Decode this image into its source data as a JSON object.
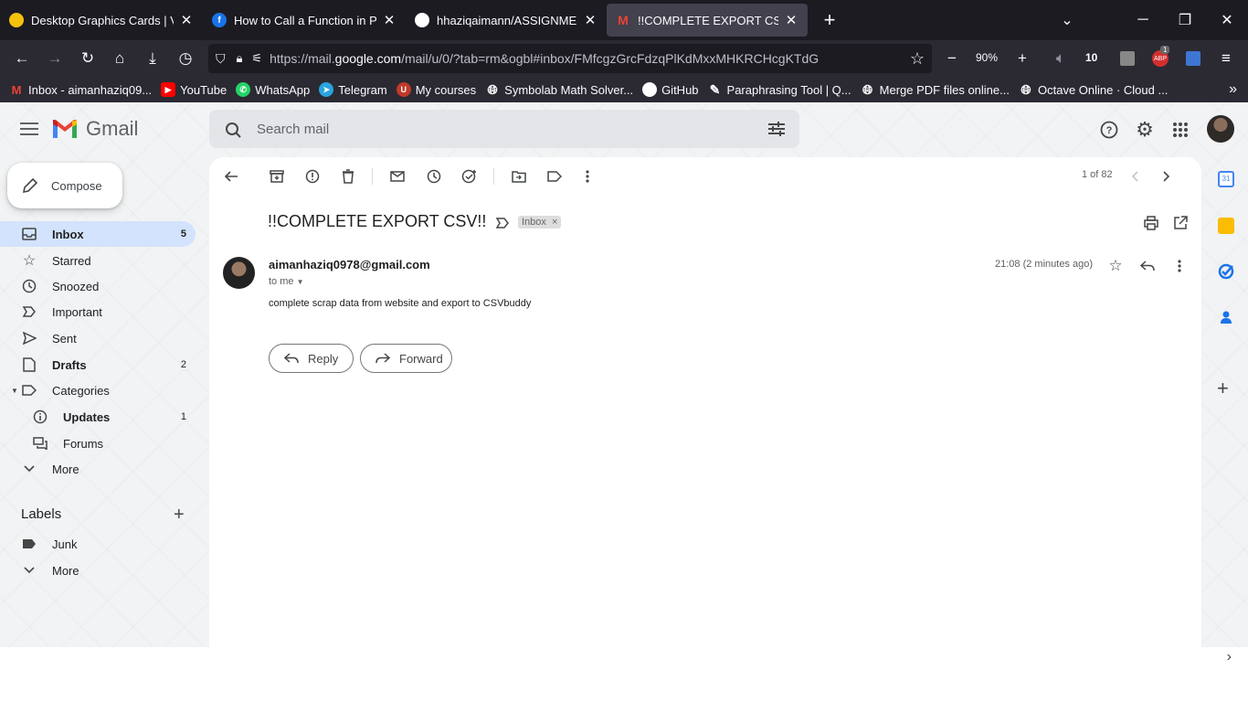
{
  "browser": {
    "tabs": [
      {
        "title": "Desktop Graphics Cards | Video",
        "icon": "nvidia-icon",
        "color": "#f4c20d"
      },
      {
        "title": "How to Call a Function in Pytho",
        "icon": "freecodecamp-icon",
        "color": "#1a73e8"
      },
      {
        "title": "hhaziqaimann/ASSIGNMENT-",
        "icon": "github-icon",
        "color": "#ffffff"
      },
      {
        "title": "!!COMPLETE EXPORT CSV!! - aim",
        "icon": "gmail-icon",
        "color": "#ea4335"
      }
    ],
    "url_prefix": "https://mail.",
    "url_domain": "google.com",
    "url_suffix": "/mail/u/0/?tab=rm&ogbl#inbox/FMfcgzGrcFdzqPlKdMxxMHKRCHcgKTdG",
    "zoom": "90%",
    "ext_badge_count": "1",
    "ext_badge_abp": "ABP",
    "ext_10": "10",
    "bookmarks": [
      {
        "label": "Inbox - aimanhaziq09...",
        "icon": "gmail-icon",
        "color": "#ea4335"
      },
      {
        "label": "YouTube",
        "icon": "youtube-icon",
        "color": "#ff0000"
      },
      {
        "label": "WhatsApp",
        "icon": "whatsapp-icon",
        "color": "#25d366"
      },
      {
        "label": "Telegram",
        "icon": "telegram-icon",
        "color": "#2aa3df"
      },
      {
        "label": "My courses",
        "icon": "courses-icon",
        "color": "#c0392b"
      },
      {
        "label": "Symbolab Math Solver...",
        "icon": "globe-icon",
        "color": "#2b2a33"
      },
      {
        "label": "GitHub",
        "icon": "github-icon",
        "color": "#2b2a33"
      },
      {
        "label": "Paraphrasing Tool | Q...",
        "icon": "quill-icon",
        "color": "#2b2a33"
      },
      {
        "label": "Merge PDF files online...",
        "icon": "globe-icon",
        "color": "#2b2a33"
      },
      {
        "label": "Octave Online · Cloud ...",
        "icon": "globe-icon",
        "color": "#2b2a33"
      }
    ]
  },
  "gmail": {
    "brand": "Gmail",
    "search_placeholder": "Search mail",
    "compose_label": "Compose",
    "nav": [
      {
        "label": "Inbox",
        "count": "5",
        "icon": "inbox-icon",
        "active": true,
        "bold": true
      },
      {
        "label": "Starred",
        "count": "",
        "icon": "star-icon"
      },
      {
        "label": "Snoozed",
        "count": "",
        "icon": "clock-icon"
      },
      {
        "label": "Important",
        "count": "",
        "icon": "important-icon"
      },
      {
        "label": "Sent",
        "count": "",
        "icon": "send-icon"
      },
      {
        "label": "Drafts",
        "count": "2",
        "icon": "draft-icon",
        "bold": true
      },
      {
        "label": "Categories",
        "count": "",
        "icon": "label-icon"
      },
      {
        "label": "Updates",
        "count": "1",
        "icon": "info-icon",
        "bold": true
      },
      {
        "label": "Forums",
        "count": "",
        "icon": "forum-icon"
      },
      {
        "label": "More",
        "count": "",
        "icon": "chevron-down-icon"
      }
    ],
    "labels_title": "Labels",
    "labels": [
      {
        "label": "Junk",
        "icon": "label-filled-icon"
      },
      {
        "label": "More",
        "icon": "chevron-down-icon"
      }
    ],
    "pager": "1 of 82",
    "email": {
      "subject": "!!COMPLETE EXPORT CSV!!",
      "chip": "Inbox",
      "chip_close": "×",
      "sender": "aimanhaziq0978@gmail.com",
      "to": "to me",
      "time": "21:08 (2 minutes ago)",
      "body": "complete scrap data from website and export to CSVbuddy"
    },
    "reply_label": "Reply",
    "forward_label": "Forward"
  }
}
